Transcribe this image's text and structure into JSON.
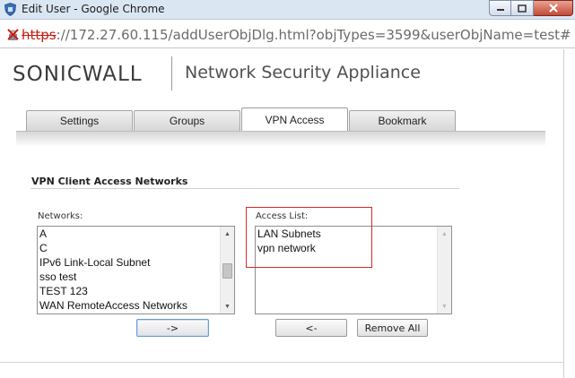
{
  "window": {
    "title": "Edit User - Google Chrome",
    "controls": {
      "minimize": "minimize",
      "maximize": "maximize",
      "close": "close"
    }
  },
  "address_bar": {
    "scheme": "https",
    "rest": "://172.27.60.115/addUserObjDlg.html?objTypes=3599&userObjName=test#",
    "security_icon": "broken-lock-x-icon"
  },
  "banner": {
    "logo": "SONICWALL",
    "product": "Network Security Appliance"
  },
  "tabs": [
    {
      "label": "Settings",
      "active": false
    },
    {
      "label": "Groups",
      "active": false
    },
    {
      "label": "VPN Access",
      "active": true
    },
    {
      "label": "Bookmark",
      "active": false
    }
  ],
  "section": {
    "title": "VPN Client Access Networks"
  },
  "networks": {
    "label": "Networks:",
    "items": [
      "A",
      "C",
      "IPv6 Link-Local Subnet",
      "sso test",
      "TEST 123",
      "WAN RemoteAccess Networks"
    ]
  },
  "access_list": {
    "label": "Access List:",
    "items": [
      "LAN Subnets",
      "vpn network"
    ]
  },
  "buttons": {
    "add": "->",
    "remove": "<-",
    "remove_all": "Remove All"
  },
  "colors": {
    "highlight": "#d12c2c",
    "titlebar": "#dbe6f3"
  }
}
